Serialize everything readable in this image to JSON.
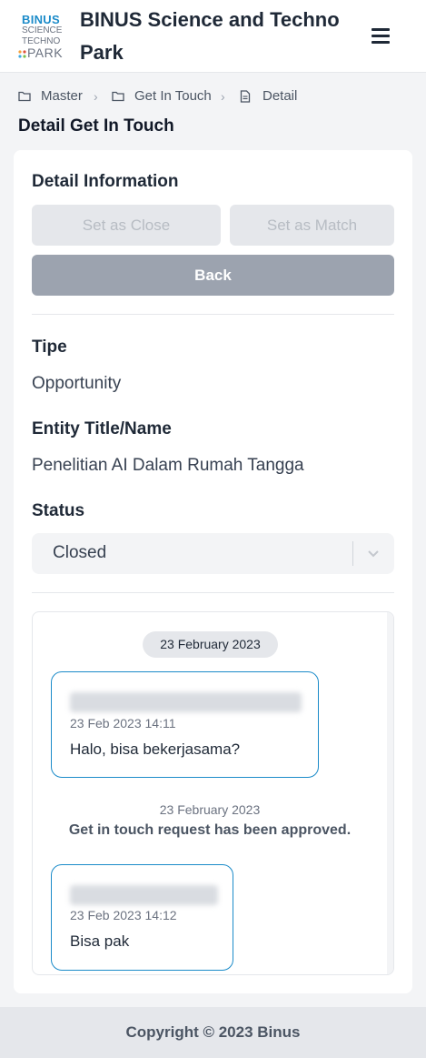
{
  "header": {
    "logo": {
      "line1": "BINUS",
      "line2": "SCIENCE",
      "line3": "TECHNO",
      "line4": "PARK"
    },
    "title": "BINUS Science and Techno Park",
    "menu_icon": "hamburger-icon"
  },
  "breadcrumb": [
    {
      "label": "Master",
      "icon": "folder-icon"
    },
    {
      "label": "Get In Touch",
      "icon": "folder-icon"
    },
    {
      "label": "Detail",
      "icon": "document-icon"
    }
  ],
  "page_title": "Detail Get In Touch",
  "detail": {
    "section_title": "Detail Information",
    "buttons": {
      "set_close": "Set as Close",
      "set_match": "Set as Match",
      "back": "Back"
    },
    "fields": {
      "tipe_label": "Tipe",
      "tipe_value": "Opportunity",
      "entity_label": "Entity Title/Name",
      "entity_value": "Penelitian AI Dalam Rumah Tangga",
      "status_label": "Status",
      "status_value": "Closed"
    }
  },
  "chat": {
    "date_pill": "23 February 2023",
    "messages": [
      {
        "time": "23 Feb 2023 14:11",
        "text": "Halo, bisa bekerjasama?"
      },
      {
        "time": "23 Feb 2023 14:12",
        "text": "Bisa pak"
      }
    ],
    "system": {
      "date": "23 February 2023",
      "text": "Get in touch request has been approved."
    }
  },
  "footer": {
    "text": "Copyright © 2023 Binus"
  },
  "colors": {
    "accent": "#1b8bc9",
    "back_button": "#9ca3af",
    "page_bg": "#f3f4f6"
  }
}
